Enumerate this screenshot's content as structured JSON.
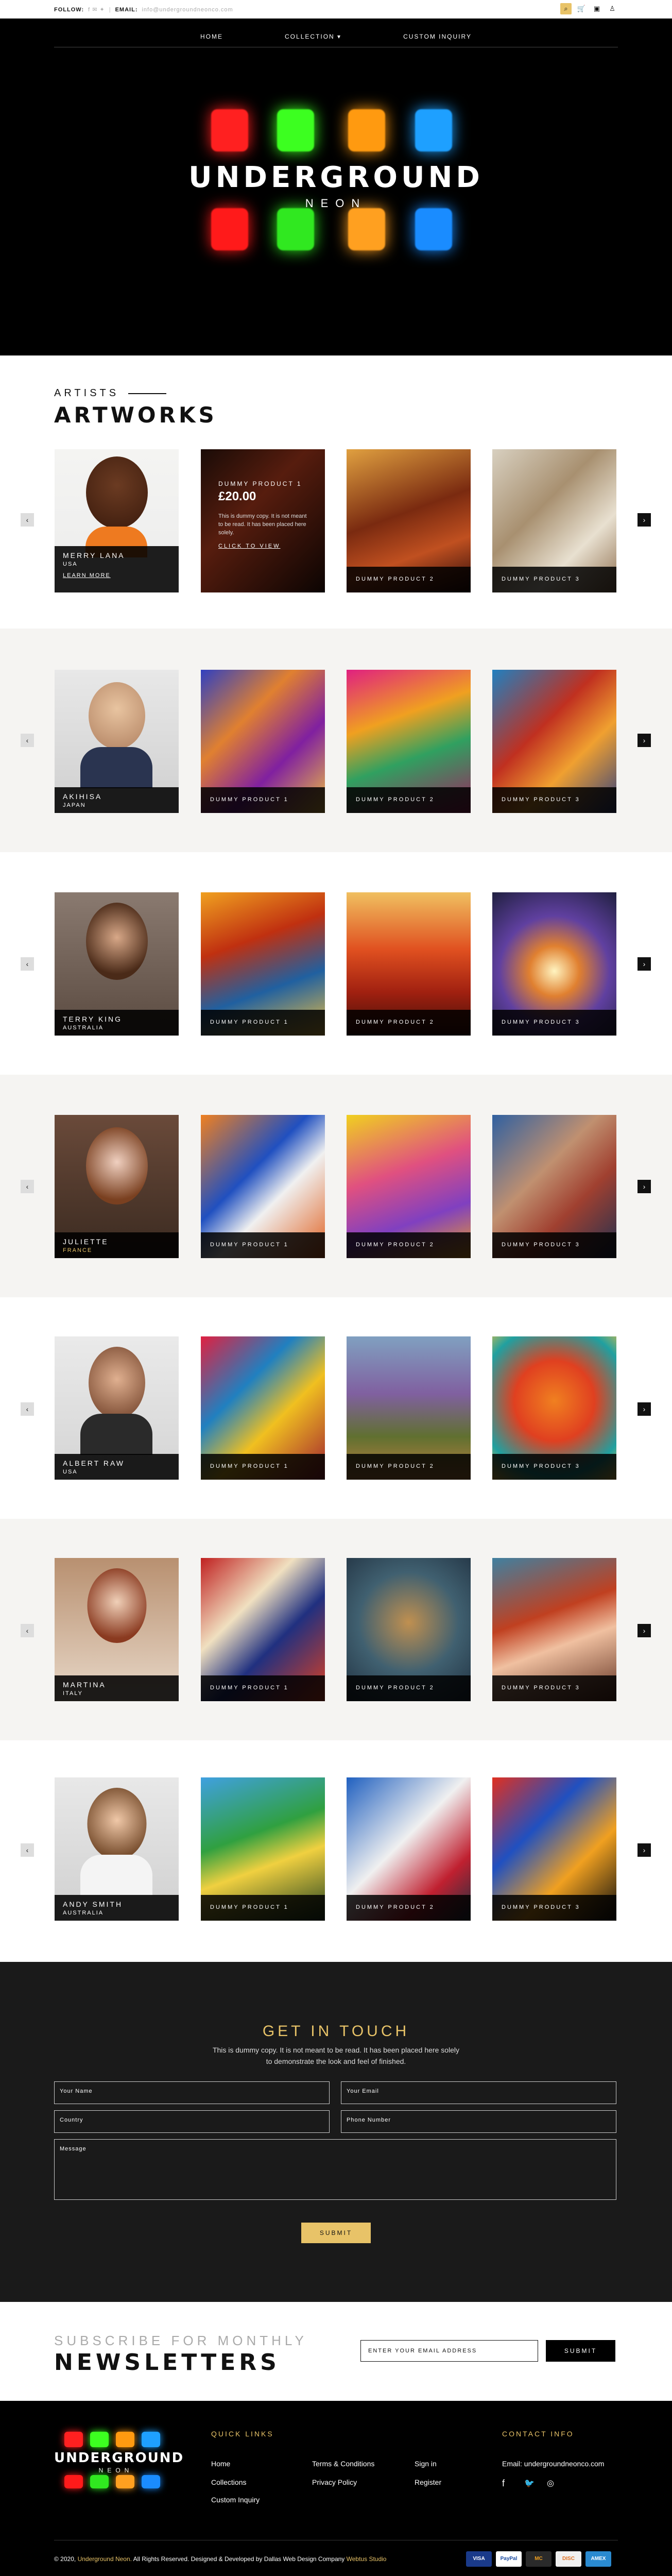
{
  "topbar": {
    "follow_label": "FOLLOW:",
    "social_icons": "f ✉ ✦",
    "email_label": "EMAIL:",
    "email": "info@undergroundneonco.com"
  },
  "nav": {
    "items": [
      "HOME",
      "COLLECTION ▾",
      "CUSTOM INQUIRY"
    ]
  },
  "hero": {
    "title": "UNDERGROUND",
    "subtitle": "NEON",
    "glow_colors": [
      "#ff2020",
      "#3cff20",
      "#ff9a10",
      "#1ea0ff",
      "#ff1a1a",
      "#30e820",
      "#ffa020",
      "#1a8cff"
    ]
  },
  "artists_heading": {
    "kicker": "ARTISTS",
    "title": "ARTWORKS"
  },
  "featured": {
    "product": "DUMMY PRODUCT 1",
    "price": "£20.00",
    "desc": "This is dummy copy. It is not meant to be read. It has been placed here solely.",
    "cta": "CLICK TO VIEW"
  },
  "artists": [
    {
      "name": "MERRY LANA",
      "country": "USA",
      "link": "LEARN MORE",
      "products": [
        "DUMMY PRODUCT 2",
        "DUMMY PRODUCT 3"
      ]
    },
    {
      "name": "AKIHISA",
      "country": "JAPAN",
      "products": [
        "DUMMY PRODUCT 1",
        "DUMMY PRODUCT 2",
        "DUMMY PRODUCT 3"
      ]
    },
    {
      "name": "TERRY KING",
      "country": "AUSTRALIA",
      "products": [
        "DUMMY PRODUCT 1",
        "DUMMY PRODUCT 2",
        "DUMMY PRODUCT 3"
      ]
    },
    {
      "name": "JULIETTE",
      "country": "FRANCE",
      "products": [
        "DUMMY PRODUCT 1",
        "DUMMY PRODUCT 2",
        "DUMMY PRODUCT 3"
      ]
    },
    {
      "name": "ALBERT RAW",
      "country": "USA",
      "products": [
        "DUMMY PRODUCT 1",
        "DUMMY PRODUCT 2",
        "DUMMY PRODUCT 3"
      ]
    },
    {
      "name": "MARTINA",
      "country": "ITALY",
      "products": [
        "DUMMY PRODUCT 1",
        "DUMMY PRODUCT 2",
        "DUMMY PRODUCT 3"
      ]
    },
    {
      "name": "ANDY SMITH",
      "country": "AUSTRALIA",
      "products": [
        "DUMMY PRODUCT 1",
        "DUMMY PRODUCT 2",
        "DUMMY PRODUCT 3"
      ]
    }
  ],
  "contact": {
    "title": "GET IN TOUCH",
    "text": "This is dummy copy. It is not meant to be read. It has been placed here solely to demonstrate the look and feel of finished.",
    "fields": {
      "name": "Your Name",
      "email": "Your Email",
      "country": "Country",
      "phone": "Phone Number",
      "message": "Message"
    },
    "submit": "SUBMIT"
  },
  "newsletter": {
    "kicker": "SUBSCRIBE FOR MONTHLY",
    "title": "NEWSLETTERS",
    "placeholder": "ENTER YOUR EMAIL ADDRESS",
    "submit": "SUBMIT"
  },
  "footer": {
    "logo_title": "UNDERGROUND",
    "logo_sub": "NEON",
    "quick_links_title": "QUICK LINKS",
    "links": [
      "Home",
      "Collections",
      "Custom Inquiry",
      "Terms & Conditions",
      "Privacy Policy",
      "Sign in",
      "Register"
    ],
    "contact_title": "CONTACT INFO",
    "email_label": "Email:",
    "email": "undergroundneonco.com",
    "social": [
      "f",
      "🐦",
      "◎"
    ],
    "copy_pre": "© 2020,",
    "copy_brand": "Underground Neon.",
    "copy_mid": "All Rights Reserved. Designed & Developed by Dallas Web Design Company",
    "copy_studio": "Webtus Studio",
    "payments": [
      "VISA",
      "PayPal",
      "MC",
      "DISC",
      "AMEX"
    ]
  }
}
